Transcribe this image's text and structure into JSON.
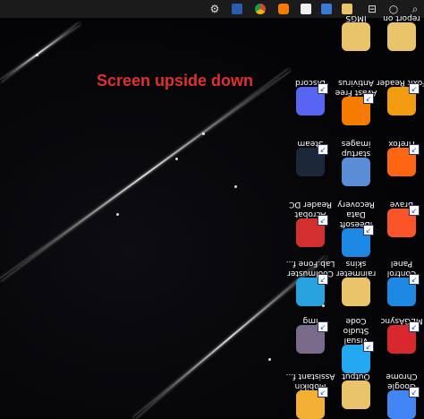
{
  "annotation": "Screen upside down",
  "taskbar": {
    "icons": [
      "settings-icon",
      "app-icon",
      "chrome-icon",
      "avast-icon",
      "mail-icon",
      "photos-icon",
      "folder-icon",
      "split-icon",
      "circle-icon",
      "brush-icon",
      "search-icon"
    ]
  },
  "desktop": {
    "items": [
      {
        "label": "report on",
        "icon": "folder-icon",
        "color": "#e9c46a"
      },
      {
        "label": "IMGS",
        "icon": "folder-icon",
        "color": "#e9c46a"
      },
      {
        "label": "Foxit Reader",
        "icon": "foxit-icon",
        "color": "#f39c12"
      },
      {
        "label": "Avast Free\nAntivirus",
        "icon": "avast-icon",
        "color": "#f57c00"
      },
      {
        "label": "Discord",
        "icon": "discord-icon",
        "color": "#5865f2"
      },
      {
        "label": "Firefox",
        "icon": "firefox-icon",
        "color": "#ff6611"
      },
      {
        "label": "startup\nimages",
        "icon": "folder-icon",
        "color": "#5b8dd6"
      },
      {
        "label": "Steam",
        "icon": "steam-icon",
        "color": "#1b2838"
      },
      {
        "label": "Brave",
        "icon": "brave-icon",
        "color": "#fb542b"
      },
      {
        "label": "iBeesoft Data\nRecovery",
        "icon": "recovery-icon",
        "color": "#1e88e5"
      },
      {
        "label": "Acrobat\nReader DC",
        "icon": "acrobat-icon",
        "color": "#d32f2f"
      },
      {
        "label": "Control Panel",
        "icon": "control-panel-icon",
        "color": "#1e88e5"
      },
      {
        "label": "rainmeter\nskins",
        "icon": "folder-icon",
        "color": "#e9c46a"
      },
      {
        "label": "Coolmuster\nLab.Fone f...",
        "icon": "coolmuster-icon",
        "color": "#29a3e0"
      },
      {
        "label": "MEGAsync",
        "icon": "mega-icon",
        "color": "#d9272e"
      },
      {
        "label": "Visual Studio\nCode",
        "icon": "vscode-icon",
        "color": "#23a9f2"
      },
      {
        "label": "img",
        "icon": "image-icon",
        "color": "#7a6a8a"
      },
      {
        "label": "Google\nChrome",
        "icon": "chrome-icon",
        "color": "#4285f4"
      },
      {
        "label": "Output",
        "icon": "folder-icon",
        "color": "#e9c46a"
      },
      {
        "label": "Mobikin\nAssistant f...",
        "icon": "mobikin-icon",
        "color": "#f2b035"
      }
    ]
  }
}
